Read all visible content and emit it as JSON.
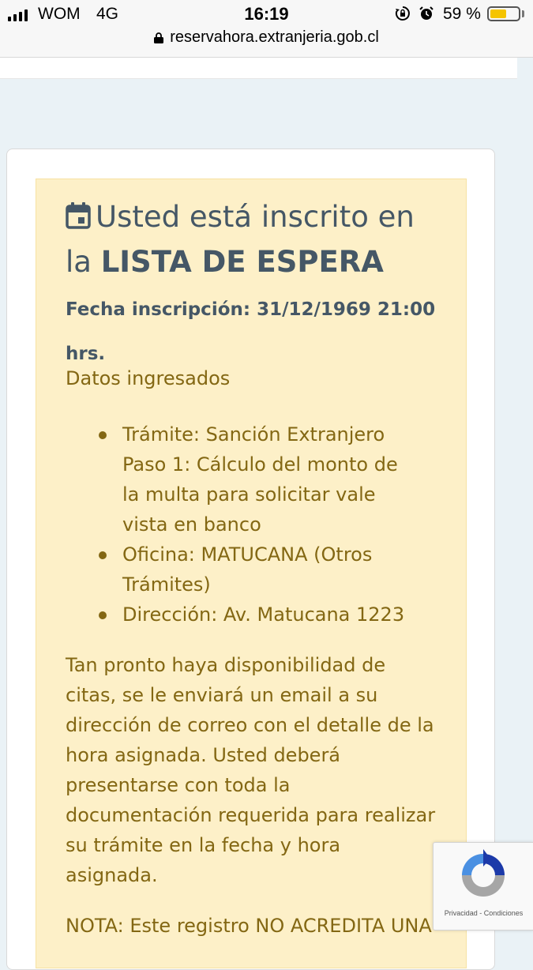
{
  "status_bar": {
    "carrier": "WOM",
    "network": "4G",
    "time": "16:19",
    "battery": "59 %",
    "battery_level": 0.59,
    "url": "reservahora.extranjeria.gob.cl"
  },
  "alert": {
    "icon": "calendar-icon",
    "title_prefix": "Usted está inscrito en la",
    "title_bold": "LISTA DE ESPERA",
    "fecha": "Fecha inscripción: 31/12/1969 21:00 hrs.",
    "datos_label": "Datos ingresados",
    "items": [
      "Trámite: Sanción Extranjero Paso 1: Cálculo del monto de la multa para solicitar vale vista en banco",
      "Oficina: MATUCANA (Otros Trámites)",
      "Dirección: Av. Matucana 1223"
    ],
    "message": "Tan pronto haya disponibilidad de citas, se le enviará un email a su dirección de correo con el detalle de la hora asignada. Usted deberá presentarse con toda la documentación requerida para realizar su trámite en la fecha y hora asignada.",
    "nota": "NOTA: Este registro NO ACREDITA UNA"
  },
  "recaptcha": {
    "links": "Privacidad - Condiciones"
  },
  "colors": {
    "alert_bg": "#fdf0c8",
    "alert_text": "#836713",
    "title_text": "#455766",
    "page_bg": "#eaf2f6"
  }
}
